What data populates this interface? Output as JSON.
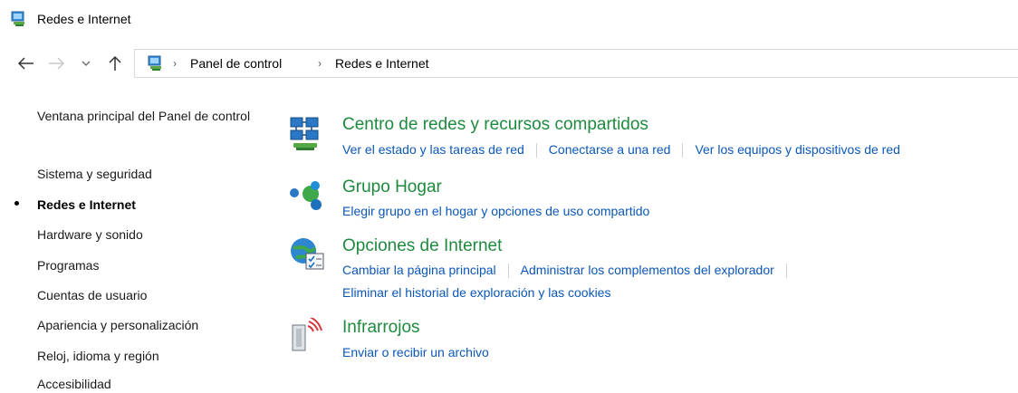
{
  "window": {
    "title": "Redes e Internet"
  },
  "address": {
    "crumbs": [
      "Panel de control",
      "Redes e Internet"
    ]
  },
  "sidebar": {
    "items": [
      {
        "label": "Ventana principal del Panel de control"
      },
      {
        "label": "Sistema y seguridad"
      },
      {
        "label": "Redes e Internet",
        "current": true
      },
      {
        "label": "Hardware y sonido"
      },
      {
        "label": "Programas"
      },
      {
        "label": "Cuentas de usuario"
      },
      {
        "label": "Apariencia y personalización"
      },
      {
        "label": "Reloj, idioma y región"
      },
      {
        "label": "Accesibilidad"
      }
    ]
  },
  "categories": [
    {
      "title": "Centro de redes y recursos compartidos",
      "icon": "network-center-icon",
      "links": [
        "Ver el estado y las tareas de red",
        "Conectarse a una red",
        "Ver los equipos y dispositivos de red"
      ]
    },
    {
      "title": "Grupo Hogar",
      "icon": "homegroup-icon",
      "links": [
        "Elegir grupo en el hogar y opciones de uso compartido"
      ]
    },
    {
      "title": "Opciones de Internet",
      "icon": "internet-options-icon",
      "links": [
        "Cambiar la página principal",
        "Administrar los complementos del explorador",
        "Eliminar el historial de exploración y las cookies"
      ]
    },
    {
      "title": "Infrarrojos",
      "icon": "infrared-icon",
      "links": [
        "Enviar o recibir un archivo"
      ]
    }
  ],
  "colors": {
    "category_title": "#1e8a3e",
    "link": "#0b57b8"
  }
}
